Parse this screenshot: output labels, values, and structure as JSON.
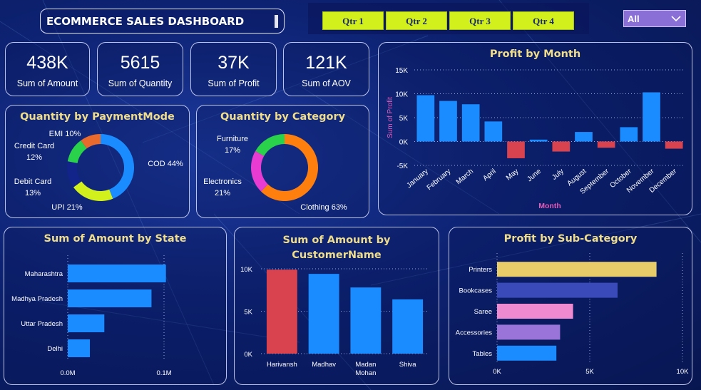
{
  "header": {
    "title": "ECOMMERCE SALES DASHBOARD"
  },
  "quarters": [
    "Qtr 1",
    "Qtr 2",
    "Qtr 3",
    "Qtr 4"
  ],
  "filter": {
    "selected": "All"
  },
  "kpis": [
    {
      "value": "438K",
      "label": "Sum of Amount"
    },
    {
      "value": "5615",
      "label": "Sum of Quantity"
    },
    {
      "value": "37K",
      "label": "Sum of Profit"
    },
    {
      "value": "121K",
      "label": "Sum of AOV"
    }
  ],
  "colors": {
    "accent_title": "#f0dd8a",
    "bar_blue": "#1a8cff",
    "bar_red": "#d9434f",
    "quarter_button": "#d2f01c",
    "filter_select": "#8a6fd6"
  },
  "chart_data": [
    {
      "type": "pie",
      "title": "Quantity by PaymentMode",
      "slices": [
        {
          "label": "COD",
          "value": 44,
          "text": "COD 44%",
          "color": "#1a8cff"
        },
        {
          "label": "UPI",
          "value": 21,
          "text": "UPI 21%",
          "color": "#d2f01c"
        },
        {
          "label": "Debit Card",
          "value": 13,
          "text": "Debit Card 13%",
          "color": "#12238a"
        },
        {
          "label": "Credit Card",
          "value": 12,
          "text": "Credit Card 12%",
          "color": "#2ad14a"
        },
        {
          "label": "EMI",
          "value": 10,
          "text": "EMI 10%",
          "color": "#e86a2c"
        }
      ]
    },
    {
      "type": "pie",
      "title": "Quantity by Category",
      "slices": [
        {
          "label": "Clothing",
          "value": 63,
          "text": "Clothing 63%",
          "color": "#ff7f0e"
        },
        {
          "label": "Electronics",
          "value": 21,
          "text": "Electronics 21%",
          "color": "#e83bd1"
        },
        {
          "label": "Furniture",
          "value": 17,
          "text": "Furniture 17%",
          "color": "#2ad14a"
        }
      ]
    },
    {
      "type": "bar",
      "title": "Profit by Month",
      "xlabel": "Month",
      "ylabel": "Sum of Profit",
      "categories": [
        "January",
        "February",
        "March",
        "April",
        "May",
        "June",
        "July",
        "August",
        "September",
        "October",
        "November",
        "December"
      ],
      "values": [
        9700,
        8500,
        7800,
        4200,
        -3500,
        400,
        -2100,
        2000,
        -1300,
        3000,
        10300,
        -1500
      ],
      "yticks": [
        "15K",
        "10K",
        "5K",
        "0K",
        "-5K"
      ],
      "ylim": [
        -5000,
        15000
      ],
      "grid": true
    },
    {
      "type": "bar",
      "orientation": "horizontal",
      "title": "Sum of Amount by State",
      "categories": [
        "Maharashtra",
        "Madhya Pradesh",
        "Uttar Pradesh",
        "Delhi"
      ],
      "values": [
        102000,
        87000,
        38000,
        23000
      ],
      "xticks": [
        "0.0M",
        "0.1M"
      ],
      "xlim": [
        0,
        100000
      ]
    },
    {
      "type": "bar",
      "title": "Sum of Amount by CustomerName",
      "categories": [
        "Harivansh",
        "Madhav",
        "Madan Mohan",
        "Shiva"
      ],
      "values": [
        9900,
        9400,
        7800,
        6400
      ],
      "colors": [
        "#d9434f",
        "#1a8cff",
        "#1a8cff",
        "#1a8cff"
      ],
      "yticks": [
        "10K",
        "5K",
        "0K"
      ],
      "ylim": [
        0,
        10000
      ]
    },
    {
      "type": "bar",
      "orientation": "horizontal",
      "title": "Profit by Sub-Category",
      "categories": [
        "Printers",
        "Bookcases",
        "Saree",
        "Accessories",
        "Tables"
      ],
      "values": [
        8600,
        6500,
        4100,
        3400,
        3200
      ],
      "colors": [
        "#e8cc6a",
        "#3a4ab8",
        "#ee8ad0",
        "#9a74d8",
        "#1a8cff"
      ],
      "xticks": [
        "0K",
        "5K",
        "10K"
      ],
      "xlim": [
        0,
        10000
      ]
    }
  ]
}
